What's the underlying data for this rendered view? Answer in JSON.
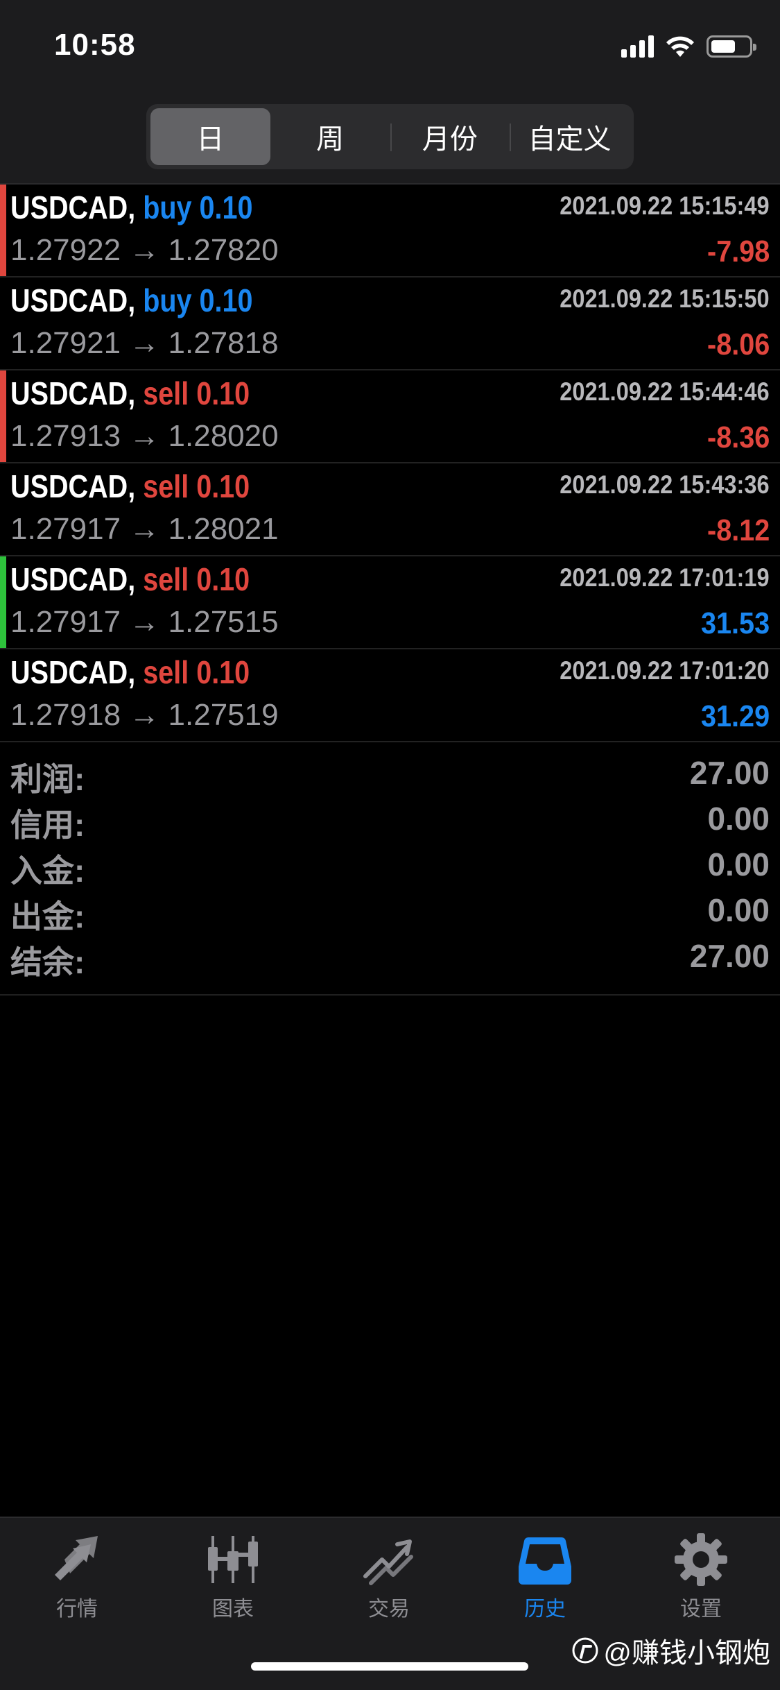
{
  "status_bar": {
    "time": "10:58"
  },
  "segments": [
    {
      "label": "日",
      "active": true
    },
    {
      "label": "周",
      "active": false
    },
    {
      "label": "月份",
      "active": false
    },
    {
      "label": "自定义",
      "active": false
    }
  ],
  "trades": [
    {
      "symbol": "USDCAD,",
      "side": "buy 0.10",
      "side_type": "buy",
      "datetime": "2021.09.22 15:15:49",
      "open": "1.27922",
      "arrow": "→",
      "close": "1.27820",
      "profit": "-7.98",
      "marker": "#e0463e"
    },
    {
      "symbol": "USDCAD,",
      "side": "buy 0.10",
      "side_type": "buy",
      "datetime": "2021.09.22 15:15:50",
      "open": "1.27921",
      "arrow": "→",
      "close": "1.27818",
      "profit": "-8.06",
      "marker": ""
    },
    {
      "symbol": "USDCAD,",
      "side": "sell 0.10",
      "side_type": "sell",
      "datetime": "2021.09.22 15:44:46",
      "open": "1.27913",
      "arrow": "→",
      "close": "1.28020",
      "profit": "-8.36",
      "marker": "#e0463e"
    },
    {
      "symbol": "USDCAD,",
      "side": "sell 0.10",
      "side_type": "sell",
      "datetime": "2021.09.22 15:43:36",
      "open": "1.27917",
      "arrow": "→",
      "close": "1.28021",
      "profit": "-8.12",
      "marker": ""
    },
    {
      "symbol": "USDCAD,",
      "side": "sell 0.10",
      "side_type": "sell",
      "datetime": "2021.09.22 17:01:19",
      "open": "1.27917",
      "arrow": "→",
      "close": "1.27515",
      "profit": "31.53",
      "marker": "#2ec23c"
    },
    {
      "symbol": "USDCAD,",
      "side": "sell 0.10",
      "side_type": "sell",
      "datetime": "2021.09.22 17:01:20",
      "open": "1.27918",
      "arrow": "→",
      "close": "1.27519",
      "profit": "31.29",
      "marker": ""
    }
  ],
  "summary": [
    {
      "label": "利润:",
      "value": "27.00"
    },
    {
      "label": "信用:",
      "value": "0.00"
    },
    {
      "label": "入金:",
      "value": "0.00"
    },
    {
      "label": "出金:",
      "value": "0.00"
    },
    {
      "label": "结余:",
      "value": "27.00"
    }
  ],
  "colors": {
    "buy": "#1a86f0",
    "sell": "#e0463e",
    "profit_positive": "#1a86f0",
    "profit_negative": "#e0463e",
    "tab_active": "#1a86f0",
    "tab_inactive": "#8e8e93"
  },
  "tabs": [
    {
      "label": "行情",
      "icon": "quotes-arrows-icon",
      "active": false
    },
    {
      "label": "图表",
      "icon": "candlestick-chart-icon",
      "active": false
    },
    {
      "label": "交易",
      "icon": "trade-chart-icon",
      "active": false
    },
    {
      "label": "历史",
      "icon": "inbox-tray-icon",
      "active": true
    },
    {
      "label": "设置",
      "icon": "gear-icon",
      "active": false
    }
  ],
  "watermark": "@赚钱小钢炮"
}
